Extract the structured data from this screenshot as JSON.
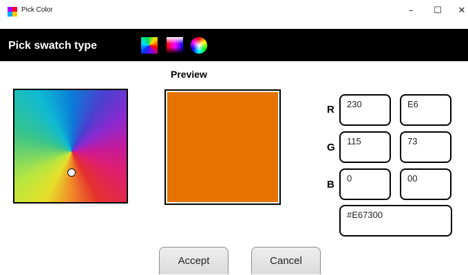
{
  "window": {
    "title": "Pick Color",
    "minimize_glyph": "–",
    "maximize_glyph": "☐",
    "close_glyph": "✕"
  },
  "swatch_bar": {
    "label": "Pick swatch type",
    "options": [
      {
        "name": "hue-square-swatch-icon"
      },
      {
        "name": "gradient-swatch-icon"
      },
      {
        "name": "color-wheel-swatch-icon"
      }
    ]
  },
  "preview": {
    "label": "Preview",
    "color": "#E67300"
  },
  "channels": {
    "r": {
      "label": "R",
      "decimal": "230",
      "hex": "E6"
    },
    "g": {
      "label": "G",
      "decimal": "115",
      "hex": "73"
    },
    "b": {
      "label": "B",
      "decimal": "0",
      "hex": "00"
    }
  },
  "hex_value": "#E67300",
  "buttons": {
    "accept": "Accept",
    "cancel": "Cancel"
  }
}
